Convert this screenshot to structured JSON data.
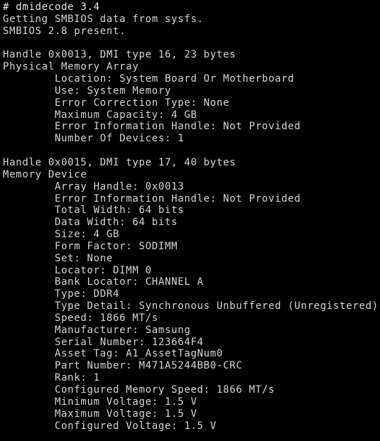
{
  "terminal": {
    "background_color": "#000000",
    "foreground_color": "#d6d6d6",
    "prompt_symbol": "#",
    "command": "dmidecode 3.4",
    "lines": [
      "# dmidecode 3.4",
      "Getting SMBIOS data from sysfs.",
      "SMBIOS 2.8 present.",
      "",
      "Handle 0x0013, DMI type 16, 23 bytes",
      "Physical Memory Array",
      "        Location: System Board Or Motherboard",
      "        Use: System Memory",
      "        Error Correction Type: None",
      "        Maximum Capacity: 4 GB",
      "        Error Information Handle: Not Provided",
      "        Number Of Devices: 1",
      "",
      "Handle 0x0015, DMI type 17, 40 bytes",
      "Memory Device",
      "        Array Handle: 0x0013",
      "        Error Information Handle: Not Provided",
      "        Total Width: 64 bits",
      "        Data Width: 64 bits",
      "        Size: 4 GB",
      "        Form Factor: SODIMM",
      "        Set: None",
      "        Locator: DIMM 0",
      "        Bank Locator: CHANNEL A",
      "        Type: DDR4",
      "        Type Detail: Synchronous Unbuffered (Unregistered)",
      "        Speed: 1866 MT/s",
      "        Manufacturer: Samsung",
      "        Serial Number: 123664F4",
      "        Asset Tag: A1_AssetTagNum0",
      "        Part Number: M471A5244BB0-CRC",
      "        Rank: 1",
      "        Configured Memory Speed: 1866 MT/s",
      "        Minimum Voltage: 1.5 V",
      "        Maximum Voltage: 1.5 V",
      "        Configured Voltage: 1.5 V"
    ],
    "sections": [
      {
        "header_version": "# dmidecode 3.4",
        "status_lines": [
          "Getting SMBIOS data from sysfs.",
          "SMBIOS 2.8 present."
        ]
      },
      {
        "handle": "Handle 0x0013, DMI type 16, 23 bytes",
        "title": "Physical Memory Array",
        "fields": [
          {
            "key": "Location",
            "value": "System Board Or Motherboard"
          },
          {
            "key": "Use",
            "value": "System Memory"
          },
          {
            "key": "Error Correction Type",
            "value": "None"
          },
          {
            "key": "Maximum Capacity",
            "value": "4 GB"
          },
          {
            "key": "Error Information Handle",
            "value": "Not Provided"
          },
          {
            "key": "Number Of Devices",
            "value": "1"
          }
        ]
      },
      {
        "handle": "Handle 0x0015, DMI type 17, 40 bytes",
        "title": "Memory Device",
        "fields": [
          {
            "key": "Array Handle",
            "value": "0x0013"
          },
          {
            "key": "Error Information Handle",
            "value": "Not Provided"
          },
          {
            "key": "Total Width",
            "value": "64 bits"
          },
          {
            "key": "Data Width",
            "value": "64 bits"
          },
          {
            "key": "Size",
            "value": "4 GB"
          },
          {
            "key": "Form Factor",
            "value": "SODIMM"
          },
          {
            "key": "Set",
            "value": "None"
          },
          {
            "key": "Locator",
            "value": "DIMM 0"
          },
          {
            "key": "Bank Locator",
            "value": "CHANNEL A"
          },
          {
            "key": "Type",
            "value": "DDR4"
          },
          {
            "key": "Type Detail",
            "value": "Synchronous Unbuffered (Unregistered)"
          },
          {
            "key": "Speed",
            "value": "1866 MT/s"
          },
          {
            "key": "Manufacturer",
            "value": "Samsung"
          },
          {
            "key": "Serial Number",
            "value": "123664F4"
          },
          {
            "key": "Asset Tag",
            "value": "A1_AssetTagNum0"
          },
          {
            "key": "Part Number",
            "value": "M471A5244BB0-CRC"
          },
          {
            "key": "Rank",
            "value": "1"
          },
          {
            "key": "Configured Memory Speed",
            "value": "1866 MT/s"
          },
          {
            "key": "Minimum Voltage",
            "value": "1.5 V"
          },
          {
            "key": "Maximum Voltage",
            "value": "1.5 V"
          },
          {
            "key": "Configured Voltage",
            "value": "1.5 V"
          }
        ]
      }
    ]
  }
}
